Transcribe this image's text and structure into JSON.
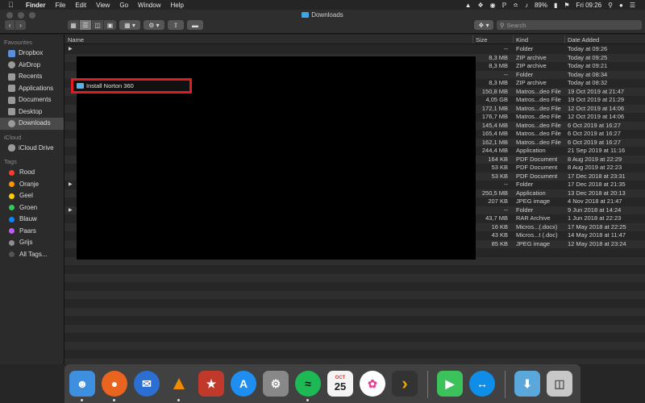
{
  "menubar": {
    "app": "Finder",
    "items": [
      "File",
      "Edit",
      "View",
      "Go",
      "Window",
      "Help"
    ],
    "battery": "89%",
    "clock": "Fri 09:26"
  },
  "window": {
    "title": "Downloads",
    "search_placeholder": "Search"
  },
  "sidebar": {
    "favourites_header": "Favourites",
    "favourites": [
      "Dropbox",
      "AirDrop",
      "Recents",
      "Applications",
      "Documents",
      "Desktop",
      "Downloads"
    ],
    "icloud_header": "iCloud",
    "icloud": [
      "iCloud Drive"
    ],
    "tags_header": "Tags",
    "tags": [
      {
        "label": "Rood",
        "color": "#ff3b30"
      },
      {
        "label": "Oranje",
        "color": "#ff9500"
      },
      {
        "label": "Geel",
        "color": "#ffcc00"
      },
      {
        "label": "Groen",
        "color": "#34c759"
      },
      {
        "label": "Blauw",
        "color": "#0a84ff"
      },
      {
        "label": "Paars",
        "color": "#bf5af2"
      },
      {
        "label": "Grijs",
        "color": "#8e8e93"
      },
      {
        "label": "All Tags...",
        "color": "#555555"
      }
    ]
  },
  "columns": {
    "name": "Name",
    "size": "Size",
    "kind": "Kind",
    "date": "Date Added"
  },
  "highlighted_item": "Install Norton 360",
  "files": [
    {
      "size": "--",
      "kind": "Folder",
      "date": "Today at 09:26"
    },
    {
      "size": "8,3 MB",
      "kind": "ZIP archive",
      "date": "Today at 09:25"
    },
    {
      "size": "8,3 MB",
      "kind": "ZIP archive",
      "date": "Today at 09:21"
    },
    {
      "size": "--",
      "kind": "Folder",
      "date": "Today at 08:34"
    },
    {
      "size": "8,3 MB",
      "kind": "ZIP archive",
      "date": "Today at 08:32"
    },
    {
      "size": "150,8 MB",
      "kind": "Matros...deo File",
      "date": "19 Oct 2019 at 21:47"
    },
    {
      "size": "4,05 GB",
      "kind": "Matros...deo File",
      "date": "19 Oct 2019 at 21:29"
    },
    {
      "size": "172,1 MB",
      "kind": "Matros...deo File",
      "date": "12 Oct 2019 at 14:06"
    },
    {
      "size": "176,7 MB",
      "kind": "Matros...deo File",
      "date": "12 Oct 2019 at 14:06"
    },
    {
      "size": "145,4 MB",
      "kind": "Matros...deo File",
      "date": "6 Oct 2019 at 16:27"
    },
    {
      "size": "165,4 MB",
      "kind": "Matros...deo File",
      "date": "6 Oct 2019 at 16:27"
    },
    {
      "size": "162,1 MB",
      "kind": "Matros...deo File",
      "date": "6 Oct 2019 at 16:27"
    },
    {
      "size": "244,4 MB",
      "kind": "Application",
      "date": "21 Sep 2019 at 11:16"
    },
    {
      "size": "164 KB",
      "kind": "PDF Document",
      "date": "8 Aug 2019 at 22:29"
    },
    {
      "size": "53 KB",
      "kind": "PDF Document",
      "date": "8 Aug 2019 at 22:23"
    },
    {
      "size": "53 KB",
      "kind": "PDF Document",
      "date": "17 Dec 2018 at 23:31"
    },
    {
      "size": "--",
      "kind": "Folder",
      "date": "17 Dec 2018 at 21:35"
    },
    {
      "size": "250,5 MB",
      "kind": "Application",
      "date": "13 Dec 2018 at 20:13"
    },
    {
      "size": "207 KB",
      "kind": "JPEG image",
      "date": "4 Nov 2018 at 21:47"
    },
    {
      "size": "--",
      "kind": "Folder",
      "date": "9 Jun 2018 at 14:24"
    },
    {
      "size": "43,7 MB",
      "kind": "RAR Archive",
      "date": "1 Jun 2018 at 22:23"
    },
    {
      "size": "16 KB",
      "kind": "Micros...(.docx)",
      "date": "17 May 2018 at 22:25"
    },
    {
      "size": "43 KB",
      "kind": "Micros...t (.doc)",
      "date": "14 May 2018 at 11:47"
    },
    {
      "size": "85 KB",
      "kind": "JPEG image",
      "date": "12 May 2018 at 23:24"
    }
  ],
  "dock": {
    "calendar_month": "OCT",
    "calendar_day": "25"
  }
}
